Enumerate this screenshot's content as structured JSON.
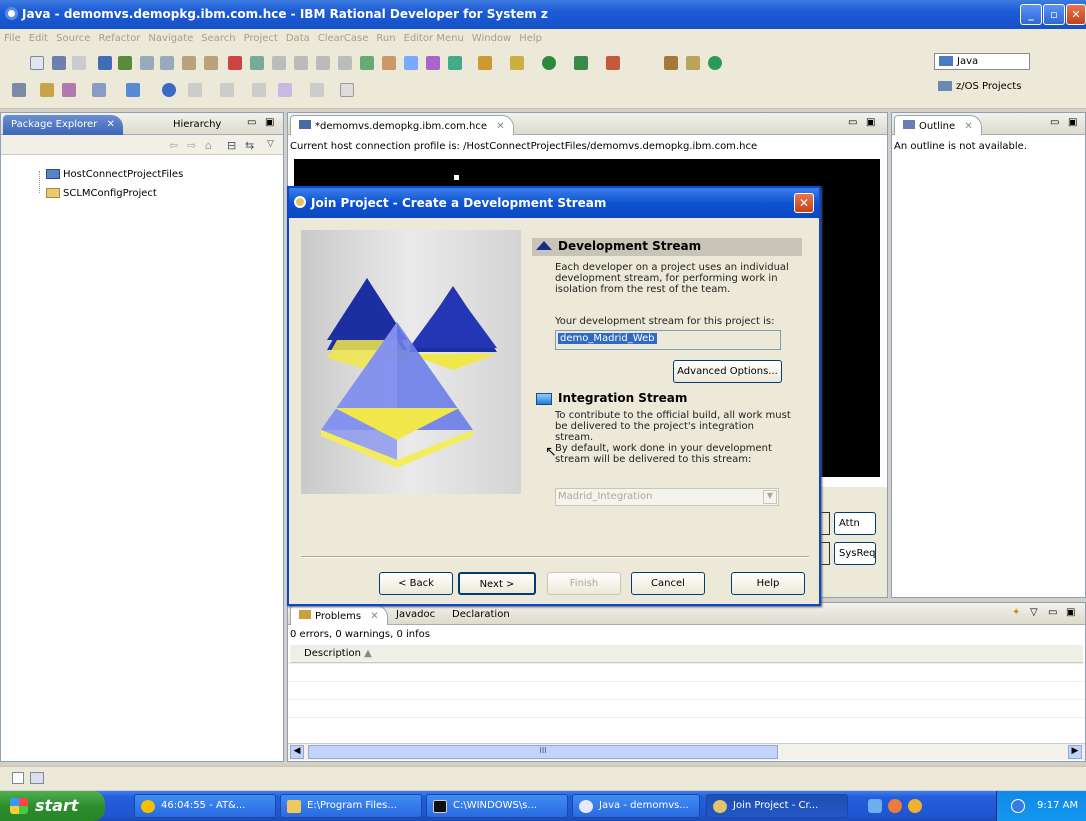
{
  "window": {
    "title": "Java - demomvs.demopkg.ibm.com.hce - IBM Rational Developer for System z"
  },
  "menu": [
    "File",
    "Edit",
    "Source",
    "Refactor",
    "Navigate",
    "Search",
    "Project",
    "Data",
    "ClearCase",
    "Run",
    "Editor Menu",
    "Window",
    "Help"
  ],
  "perspectives": {
    "java": "Java",
    "zos": "z/OS Projects"
  },
  "left_panel": {
    "tabs": [
      "Package Explorer",
      "Hierarchy"
    ],
    "items": [
      "HostConnectProjectFiles",
      "SCLMConfigProject"
    ]
  },
  "editor": {
    "tab": "*demomvs.demopkg.ibm.com.hce",
    "profile_text": "Current host connection profile is: /HostConnectProjectFiles/demomvs.demopkg.ibm.com.hce",
    "buttons": {
      "attn": "Attn",
      "sysreq": "SysReq"
    }
  },
  "outline": {
    "tab": "Outline",
    "message": "An outline is not available."
  },
  "bottom": {
    "tabs": [
      "Problems",
      "Javadoc",
      "Declaration"
    ],
    "summary": "0 errors, 0 warnings, 0 infos",
    "column": "Description",
    "scroll_label": "III"
  },
  "dialog": {
    "title": "Join Project - Create a Development Stream",
    "dev_heading": "Development Stream",
    "dev_desc_1": "Each developer on a project uses an individual",
    "dev_desc_2": "development stream, for performing work in",
    "dev_desc_3": "isolation from the rest of the team.",
    "dev_prompt": "Your development stream for this project is:",
    "dev_value": "demo_Madrid_Web",
    "advanced": "Advanced Options...",
    "int_heading": "Integration Stream",
    "int_desc_1": "To contribute to the official build, all work must",
    "int_desc_2": "be delivered to the project's integration",
    "int_desc_3": "stream.",
    "int_desc_4": "By default, work done in your development",
    "int_desc_5": "stream will be delivered to this stream:",
    "int_value": "Madrid_Integration",
    "buttons": {
      "back": "< Back",
      "next": "Next >",
      "finish": "Finish",
      "cancel": "Cancel",
      "help": "Help"
    }
  },
  "taskbar": {
    "start": "start",
    "tasks": [
      "46:04:55 - AT&...",
      "E:\\Program Files...",
      "C:\\WINDOWS\\s...",
      "Java - demomvs...",
      "Join Project - Cr..."
    ],
    "clock": "9:17 AM"
  },
  "colors": {
    "xp_blue": "#1552c6",
    "dialog_section": "#c8c5b8",
    "selection": "#316ac5",
    "pyramid_yellow": "#f0e84a",
    "pyramid_blue": "#1c2fa0"
  }
}
